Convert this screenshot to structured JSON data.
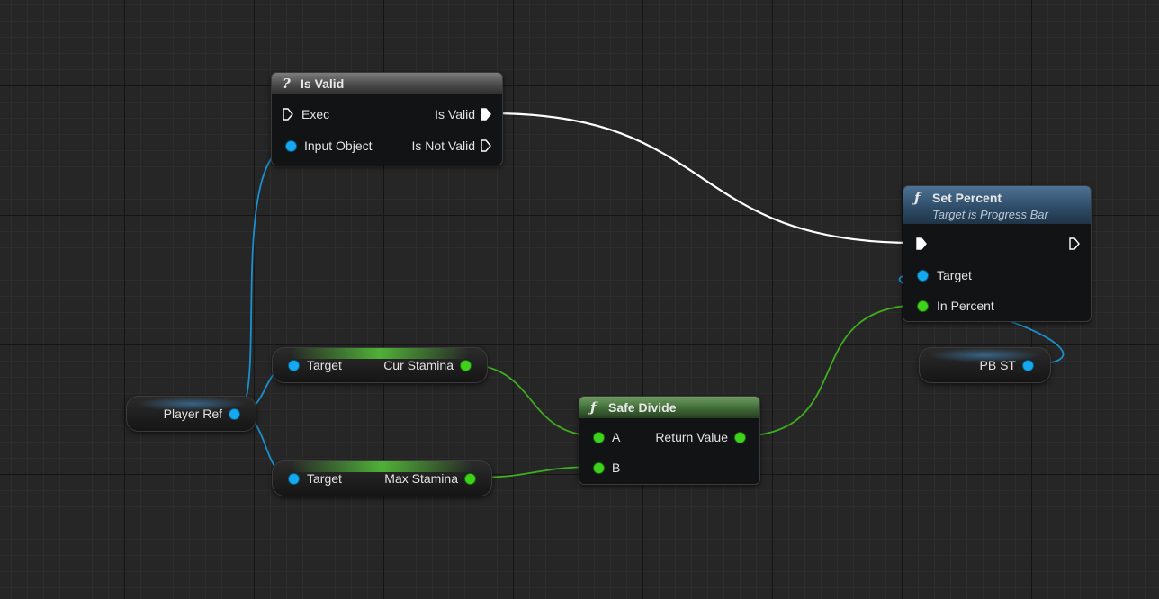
{
  "nodes": {
    "is_valid": {
      "title": "Is Valid",
      "glyph": "?",
      "in_exec": "Exec",
      "in_object": "Input Object",
      "out_valid": "Is Valid",
      "out_not_valid": "Is Not Valid"
    },
    "set_percent": {
      "title": "Set Percent",
      "glyph": "ƒ",
      "subtitle": "Target is Progress Bar",
      "target": "Target",
      "in_percent": "In Percent"
    },
    "safe_divide": {
      "title": "Safe Divide",
      "glyph": "ƒ",
      "a": "A",
      "b": "B",
      "ret": "Return Value"
    },
    "get_cur_stamina": {
      "target": "Target",
      "value": "Cur Stamina"
    },
    "get_max_stamina": {
      "target": "Target",
      "value": "Max Stamina"
    },
    "player_ref": {
      "label": "Player Ref"
    },
    "pb_st": {
      "label": "PB ST"
    }
  },
  "colors": {
    "exec": "#ffffff",
    "object_pin": "#14a9f0",
    "float_pin": "#3ed21c"
  },
  "icons": {
    "exec_pin": "exec-arrow-icon",
    "function": "function-icon",
    "question": "question-icon"
  }
}
